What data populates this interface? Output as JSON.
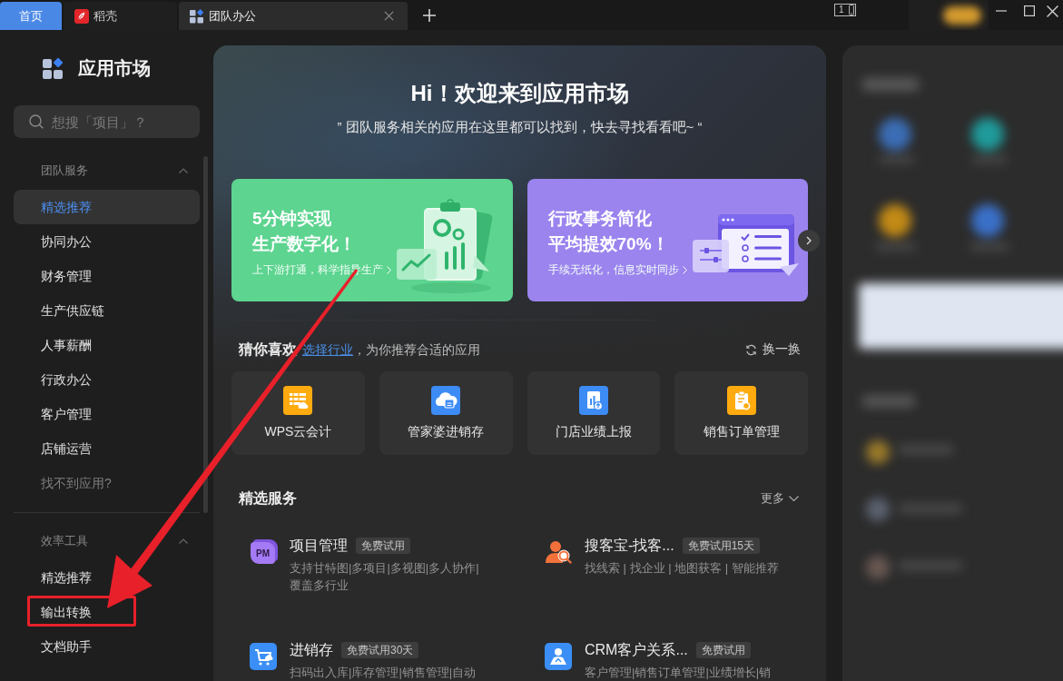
{
  "tabs": [
    {
      "kind": "home",
      "label": "首页",
      "selected": false
    },
    {
      "kind": "docer",
      "label": "稻壳",
      "selected": false
    },
    {
      "kind": "apps",
      "label": "团队办公",
      "selected": true
    }
  ],
  "title_bar": {
    "screen_count": "1"
  },
  "sidebar": {
    "title": "应用市场",
    "search": {
      "placeholder": "想搜「项目」？"
    },
    "sections": [
      {
        "title": "团队服务",
        "expanded": true,
        "items": [
          {
            "kind": "category",
            "label": "精选推荐",
            "selected": true,
            "highlighted": false
          },
          {
            "kind": "category",
            "label": "协同办公",
            "selected": false,
            "highlighted": false
          },
          {
            "kind": "category",
            "label": "财务管理",
            "selected": false,
            "highlighted": false
          },
          {
            "kind": "category",
            "label": "生产供应链",
            "selected": false,
            "highlighted": false
          },
          {
            "kind": "category",
            "label": "人事薪酬",
            "selected": false,
            "highlighted": false
          },
          {
            "kind": "category",
            "label": "行政办公",
            "selected": false,
            "highlighted": false
          },
          {
            "kind": "category",
            "label": "客户管理",
            "selected": false,
            "highlighted": false
          },
          {
            "kind": "category",
            "label": "店铺运营",
            "selected": false,
            "highlighted": false
          },
          {
            "kind": "help",
            "label": "找不到应用?",
            "selected": false,
            "highlighted": false
          }
        ]
      },
      {
        "title": "效率工具",
        "expanded": true,
        "items": [
          {
            "kind": "category",
            "label": "精选推荐",
            "selected": false,
            "highlighted": false
          },
          {
            "kind": "category",
            "label": "输出转换",
            "selected": false,
            "highlighted": true
          },
          {
            "kind": "category",
            "label": "文档助手",
            "selected": false,
            "highlighted": false
          }
        ]
      }
    ]
  },
  "hero": {
    "title": "Hi！欢迎来到应用市场",
    "subtitle": "” 团队服务相关的应用在这里都可以找到，快去寻找看看吧~ “"
  },
  "banners": [
    {
      "kind": "clipboard",
      "color": "#5dd490",
      "title": [
        "5分钟实现",
        "生产数字化！"
      ],
      "subtitle": "上下游打通，科学指导生产"
    },
    {
      "kind": "checklist",
      "color": "#9b84ee",
      "title": [
        "行政事务简化",
        "平均提效70%！"
      ],
      "subtitle": "手续无纸化，信息实时同步"
    }
  ],
  "recommend": {
    "title": "猜你喜欢",
    "link": "选择行业",
    "hint": "，为你推荐合适的应用",
    "refresh": "换一换",
    "apps": [
      {
        "kind": "ledger",
        "color": "#ffab0f",
        "label": "WPS云会计"
      },
      {
        "kind": "cloud",
        "color": "#3d8bf5",
        "label": "管家婆进销存"
      },
      {
        "kind": "report",
        "color": "#3d8bf5",
        "label": "门店业绩上报"
      },
      {
        "kind": "order",
        "color": "#ffab0f",
        "label": "销售订单管理"
      }
    ]
  },
  "services": {
    "title": "精选服务",
    "more": "更多",
    "items": [
      {
        "kind": "pm",
        "icon_label": "PM",
        "name": "项目管理",
        "badge": "免费试用",
        "description": "支持甘特图|多项目|多视图|多人协作|覆盖多行业"
      },
      {
        "kind": "search",
        "name": "搜客宝-找客...",
        "badge": "免费试用15天",
        "description": "找线索 | 找企业 | 地图获客 | 智能推荐"
      },
      {
        "kind": "cart",
        "name": "进销存",
        "badge": "免费试用30天",
        "description": "扫码出入库|库存管理|销售管理|自动"
      },
      {
        "kind": "map",
        "name": "CRM客户关系...",
        "badge": "免费试用",
        "description": "客户管理|销售订单管理|业绩增长|销"
      }
    ]
  }
}
